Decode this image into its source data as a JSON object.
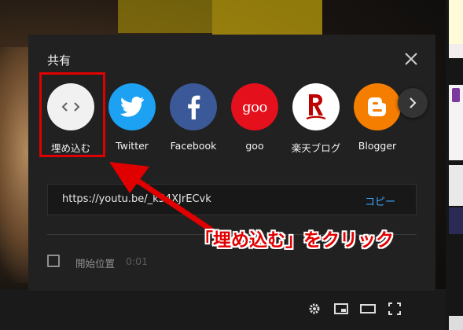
{
  "dialog": {
    "title": "共有",
    "url": "https://youtu.be/_k54XJrECvk",
    "copy_label": "コピー",
    "start_position_label": "開始位置",
    "start_time": "0:01"
  },
  "share_items": [
    {
      "label": "埋め込む",
      "icon": "embed-code-icon",
      "color": "#f1f1f1"
    },
    {
      "label": "Twitter",
      "icon": "twitter-bird-icon",
      "color": "#1da1f2"
    },
    {
      "label": "Facebook",
      "icon": "facebook-f-icon",
      "color": "#3b5998"
    },
    {
      "label": "goo",
      "icon": "goo-logo-icon",
      "color": "#e4101c"
    },
    {
      "label": "楽天ブログ",
      "icon": "rakuten-r-icon",
      "color": "#ffffff"
    },
    {
      "label": "Blogger",
      "icon": "blogger-b-icon",
      "color": "#f57d00"
    }
  ],
  "goo_logo_text": "goo",
  "annotation": {
    "caption": "「埋め込む」をクリック",
    "color": "#e00000"
  }
}
